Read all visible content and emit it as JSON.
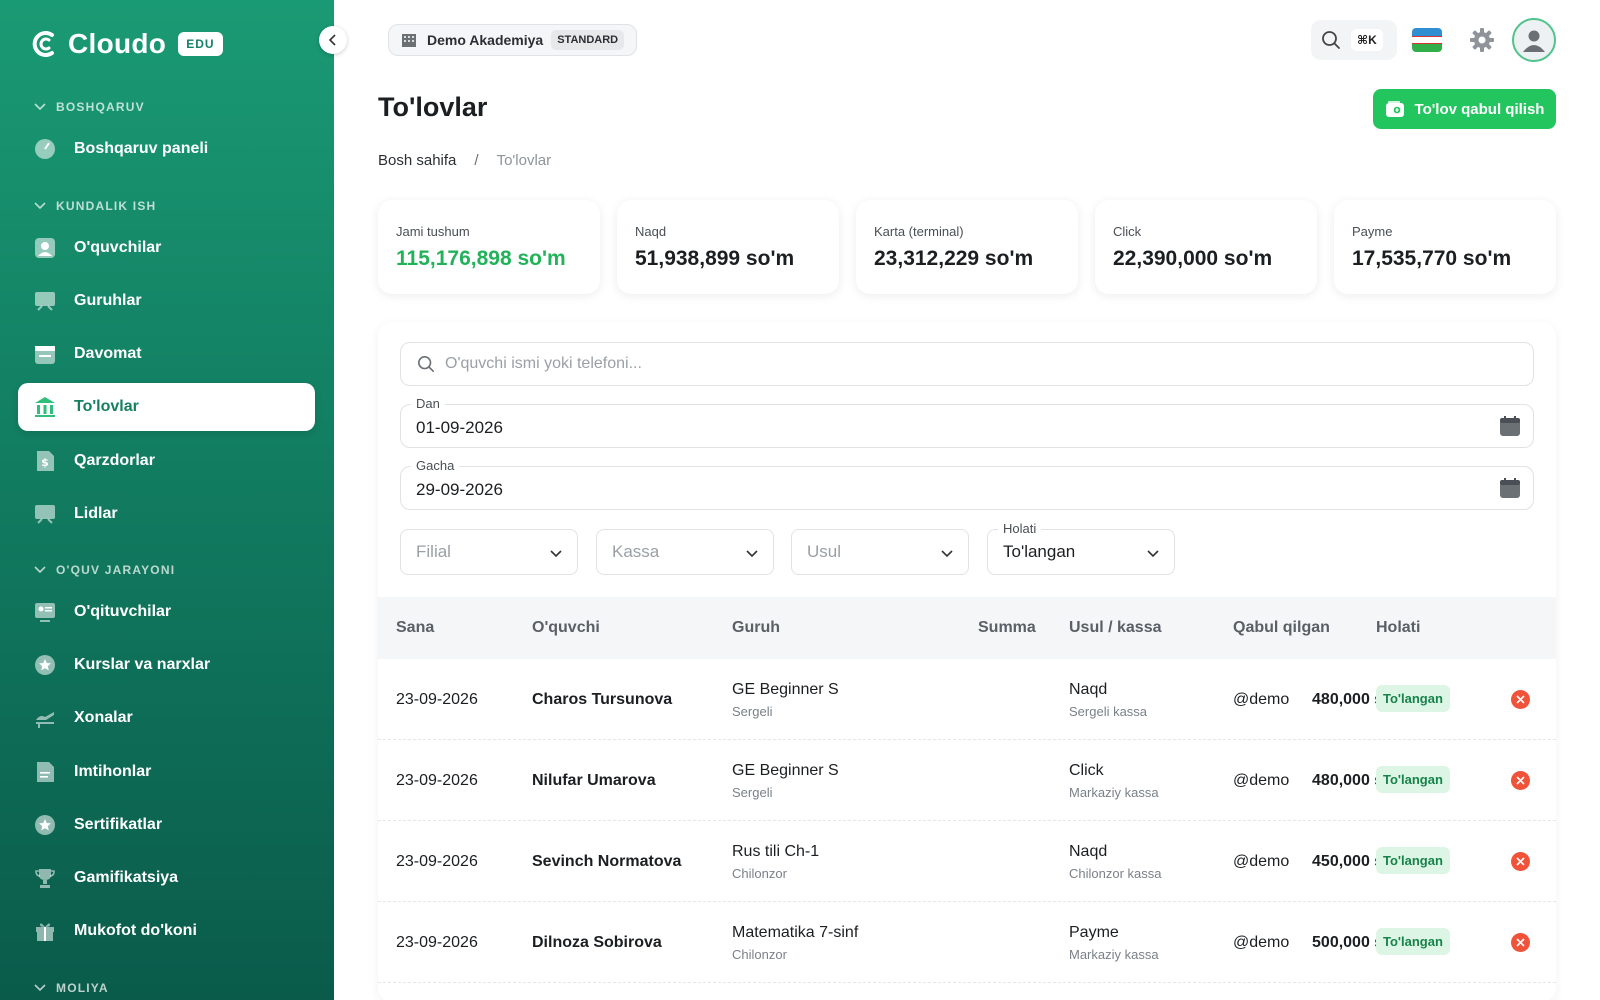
{
  "brand": {
    "name": "Cloudo",
    "badge": "EDU"
  },
  "sidebar": {
    "sections": [
      {
        "label": "BOSHQARUV"
      },
      {
        "label": "KUNDALIK ISH"
      },
      {
        "label": "O'QUV JARAYONI"
      },
      {
        "label": "MOLIYA"
      }
    ],
    "items": [
      {
        "label": "Boshqaruv paneli",
        "icon": "dashboard-icon"
      },
      {
        "label": "O'quvchilar",
        "icon": "student-icon"
      },
      {
        "label": "Guruhlar",
        "icon": "group-icon"
      },
      {
        "label": "Davomat",
        "icon": "calendar-icon"
      },
      {
        "label": "To'lovlar",
        "icon": "bank-icon",
        "active": true
      },
      {
        "label": "Qarzdorlar",
        "icon": "debt-icon"
      },
      {
        "label": "Lidlar",
        "icon": "leads-icon"
      },
      {
        "label": "O'qituvchilar",
        "icon": "teacher-icon"
      },
      {
        "label": "Kurslar va narxlar",
        "icon": "star-icon"
      },
      {
        "label": "Xonalar",
        "icon": "room-icon"
      },
      {
        "label": "Imtihonlar",
        "icon": "exam-icon"
      },
      {
        "label": "Sertifikatlar",
        "icon": "certificate-icon"
      },
      {
        "label": "Gamifikatsiya",
        "icon": "trophy-icon"
      },
      {
        "label": "Mukofot do'koni",
        "icon": "gift-icon"
      }
    ]
  },
  "topbar": {
    "org_name": "Demo Akademiya",
    "org_plan": "STANDARD",
    "shortcut": "⌘K"
  },
  "header": {
    "title": "To'lovlar",
    "action_button": "To'lov qabul qilish",
    "breadcrumb": {
      "home": "Bosh sahifa",
      "separator": "/",
      "current": "To'lovlar"
    }
  },
  "stats": [
    {
      "label": "Jami tushum",
      "value": "115,176,898 so'm",
      "accent": "#22b25a"
    },
    {
      "label": "Naqd",
      "value": "51,938,899 so'm"
    },
    {
      "label": "Karta (terminal)",
      "value": "23,312,229 so'm"
    },
    {
      "label": "Click",
      "value": "22,390,000 so'm"
    },
    {
      "label": "Payme",
      "value": "17,535,770 so'm"
    }
  ],
  "filters": {
    "search_placeholder": "O'quvchi ismi yoki telefoni...",
    "date_from": {
      "label": "Dan",
      "value": "01-09-2026"
    },
    "date_to": {
      "label": "Gacha",
      "value": "29-09-2026"
    },
    "branch": {
      "placeholder": "Filial"
    },
    "cashbox": {
      "placeholder": "Kassa"
    },
    "method": {
      "placeholder": "Usul"
    },
    "status": {
      "label": "Holati",
      "value": "To'langan"
    }
  },
  "table": {
    "columns": [
      "Sana",
      "O'quvchi",
      "Guruh",
      "Summa",
      "Usul / kassa",
      "Qabul qilgan",
      "Holati"
    ],
    "rows": [
      {
        "date": "23-09-2026",
        "student": "Charos Tursunova",
        "group": "GE Beginner S",
        "branch": "Sergeli",
        "amount": "480,000 so'm",
        "method": "Naqd",
        "cashbox": "Sergeli kassa",
        "by": "@demo",
        "status": "To'langan"
      },
      {
        "date": "23-09-2026",
        "student": "Nilufar Umarova",
        "group": "GE Beginner S",
        "branch": "Sergeli",
        "amount": "480,000 so'm",
        "method": "Click",
        "cashbox": "Markaziy kassa",
        "by": "@demo",
        "status": "To'langan"
      },
      {
        "date": "23-09-2026",
        "student": "Sevinch Normatova",
        "group": "Rus tili Ch-1",
        "branch": "Chilonzor",
        "amount": "450,000 so'm",
        "method": "Naqd",
        "cashbox": "Chilonzor kassa",
        "by": "@demo",
        "status": "To'langan"
      },
      {
        "date": "23-09-2026",
        "student": "Dilnoza Sobirova",
        "group": "Matematika 7-sinf",
        "branch": "Chilonzor",
        "amount": "500,000 so'm",
        "method": "Payme",
        "cashbox": "Markaziy kassa",
        "by": "@demo",
        "status": "To'langan"
      }
    ]
  },
  "colors": {
    "brand_green": "#14826a",
    "accent_green": "#22c55e",
    "danger": "#f0533a"
  }
}
